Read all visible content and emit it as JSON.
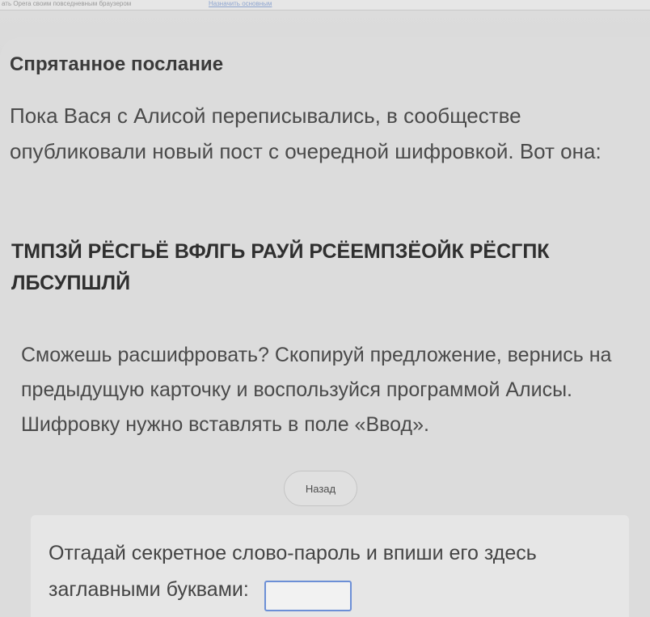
{
  "browser": {
    "notice_text": "ать Opera своим повседневным браузером",
    "notice_link": "Назначить основным"
  },
  "card": {
    "title": "Спрятанное послание",
    "intro": "Пока Вася с Алисой переписывались, в сообществе опубликовали новый пост с очередной шифровкой. Вот она:",
    "cipher_line1": "ТМПЗЙ РЁСГЬЁ ВФЛГЬ РАУЙ РСЁЕМПЗЁОЙК РЁСГПК",
    "cipher_line2": "ЛБСУПШЛЙ",
    "instructions": "Сможешь расшифровать? Скопируй предложение, вернись на предыдущую карточку и воспользуйся программой Алисы. Шифровку нужно вставлять в поле «Ввод».",
    "back_label": "Назад"
  },
  "answer": {
    "prompt_line1": "Отгадай секретное слово-пароль и впиши его здесь",
    "prompt_line2": "заглавными буквами:",
    "input_value": ""
  }
}
